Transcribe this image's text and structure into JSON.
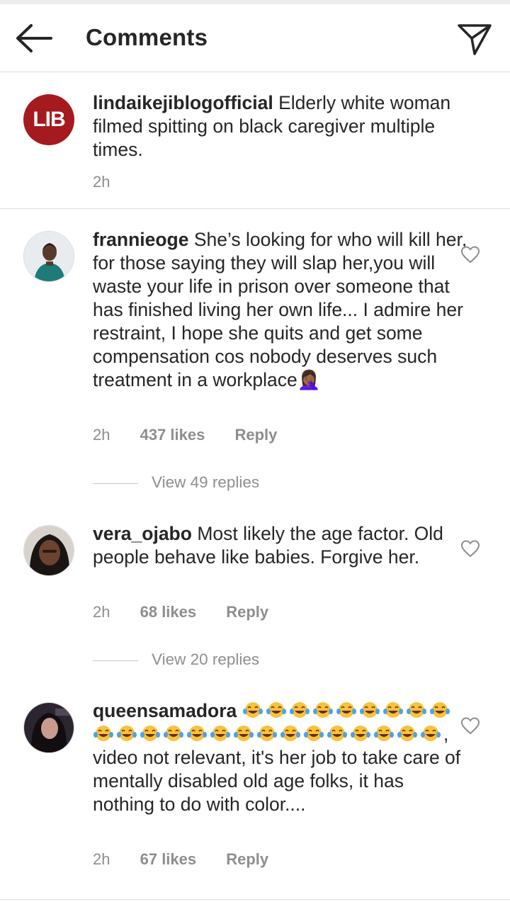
{
  "header": {
    "title": "Comments",
    "back_icon": "arrow-left-icon",
    "share_icon": "paper-plane-icon"
  },
  "caption": {
    "avatar_text": "LIB",
    "username": "lindaikejiblogofficial",
    "text": "Elderly white woman filmed spitting on black caregiver multiple times.",
    "time": "2h"
  },
  "comments": [
    {
      "username": "frannieoge",
      "text": "She’s looking for who will kill her, for those saying they will slap her,you will waste your life in prison over someone that has finished living her own life... I admire her restraint, I hope she quits and get some compensation cos nobody deserves such treatment in a workplace",
      "trailing_emoji": "🤦🏾‍♀️",
      "time": "2h",
      "likes": "437 likes",
      "reply": "Reply",
      "view_replies": "View 49 replies"
    },
    {
      "username": "vera_ojabo",
      "text": "Most likely the age factor. Old people behave like babies. Forgive her.",
      "time": "2h",
      "likes": "68 likes",
      "reply": "Reply",
      "view_replies": "View 20 replies"
    },
    {
      "username": "queensamadora",
      "emoji_count": 24,
      "emoji": "😂",
      "text": ", video not relevant,  it's her job to take care of mentally disabled old age folks,  it has nothing to do with color....",
      "time": "2h",
      "likes": "67 likes",
      "reply": "Reply"
    }
  ],
  "colors": {
    "text": "#262626",
    "meta": "#8e8e8e",
    "divider": "#dbdbdb",
    "lib_red": "#a51a1e"
  }
}
